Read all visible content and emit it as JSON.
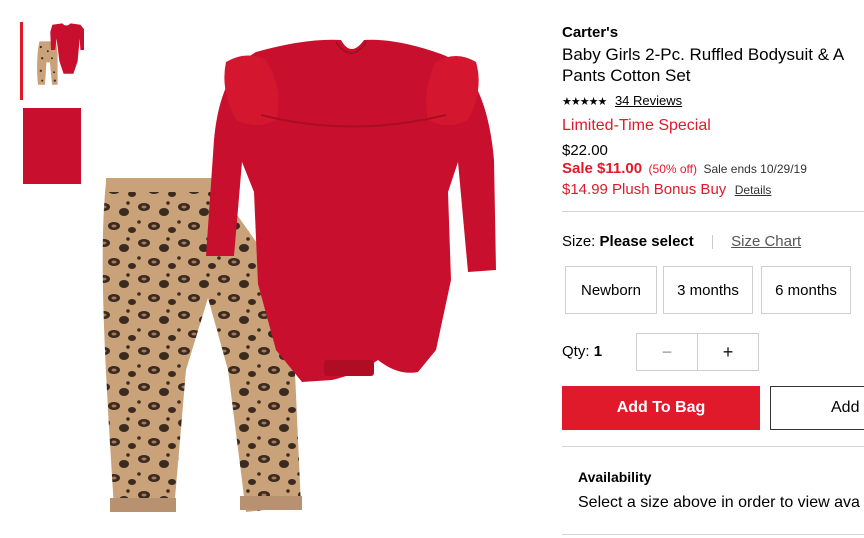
{
  "gallery": {
    "thumbnails": [
      {
        "name": "outfit-thumbnail",
        "selected": true
      },
      {
        "name": "fabric-swatch-thumbnail",
        "selected": false
      }
    ]
  },
  "product": {
    "brand": "Carter's",
    "title_line1": "Baby Girls 2-Pc. Ruffled Bodysuit & A",
    "title_line2": "Pants Cotton Set",
    "rating_stars": "★★★★★",
    "reviews_label": "34 Reviews",
    "promo_label": "Limited-Time Special",
    "original_price": "$22.00",
    "sale_price": "Sale $11.00",
    "discount": "(50% off)",
    "sale_ends": "Sale ends 10/29/19",
    "bonus_offer": "$14.99 Plush Bonus Buy",
    "details_link": "Details"
  },
  "size": {
    "label": "Size:",
    "value": "Please select",
    "chart_link": "Size Chart",
    "options": [
      "Newborn",
      "3 months",
      "6 months"
    ]
  },
  "quantity": {
    "label": "Qty:",
    "value": "1",
    "minus": "−",
    "plus": "+"
  },
  "actions": {
    "add_to_bag": "Add To Bag",
    "add_to_list": "Add"
  },
  "availability": {
    "title": "Availability",
    "message": "Select a size above in order to view ava"
  },
  "colors": {
    "accent_red": "#e11a2b",
    "bodysuit_red": "#c8102e",
    "border_gray": "#cfcfcf"
  }
}
